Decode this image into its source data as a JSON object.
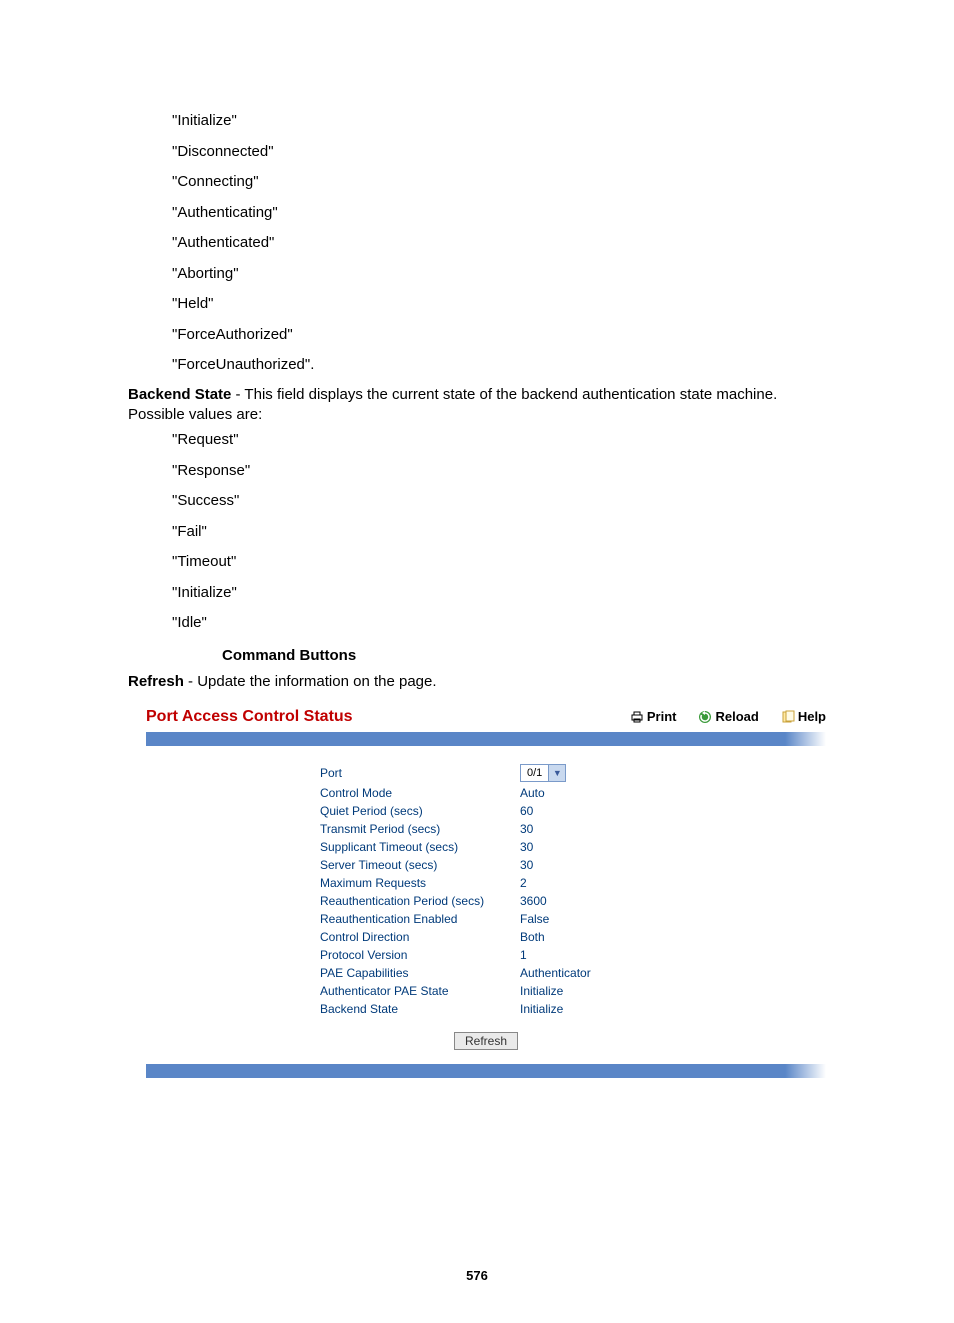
{
  "pae_states": [
    "\"Initialize\"",
    "\"Disconnected\"",
    "\"Connecting\"",
    "\"Authenticating\"",
    "\"Authenticated\"",
    "\"Aborting\"",
    "\"Held\"",
    "\"ForceAuthorized\"",
    "\"ForceUnauthorized\"."
  ],
  "backend_label": "Backend State",
  "backend_desc": " - This field displays the current state of the backend authentication state machine. Possible values are:",
  "backend_states": [
    "\"Request\"",
    "\"Response\"",
    "\"Success\"",
    "\"Fail\"",
    "\"Timeout\"",
    "\"Initialize\"",
    "\"Idle\""
  ],
  "cmd_heading": "Command Buttons",
  "refresh_label": "Refresh",
  "refresh_desc": " - Update the information on the page.",
  "panel": {
    "title": "Port Access Control Status",
    "actions": {
      "print": "Print",
      "reload": "Reload",
      "help": "Help"
    },
    "rows": [
      {
        "label": "Port",
        "value": "0/1",
        "type": "select"
      },
      {
        "label": "Control Mode",
        "value": "Auto"
      },
      {
        "label": "Quiet Period (secs)",
        "value": "60"
      },
      {
        "label": "Transmit Period (secs)",
        "value": "30"
      },
      {
        "label": "Supplicant Timeout (secs)",
        "value": "30"
      },
      {
        "label": "Server Timeout (secs)",
        "value": "30"
      },
      {
        "label": "Maximum Requests",
        "value": "2"
      },
      {
        "label": "Reauthentication Period (secs)",
        "value": "3600"
      },
      {
        "label": "Reauthentication Enabled",
        "value": "False"
      },
      {
        "label": "Control Direction",
        "value": "Both"
      },
      {
        "label": "Protocol Version",
        "value": "1"
      },
      {
        "label": "PAE Capabilities",
        "value": "Authenticator"
      },
      {
        "label": "Authenticator PAE State",
        "value": "Initialize"
      },
      {
        "label": "Backend State",
        "value": "Initialize"
      }
    ],
    "refresh_btn": "Refresh"
  },
  "page_number": "576"
}
